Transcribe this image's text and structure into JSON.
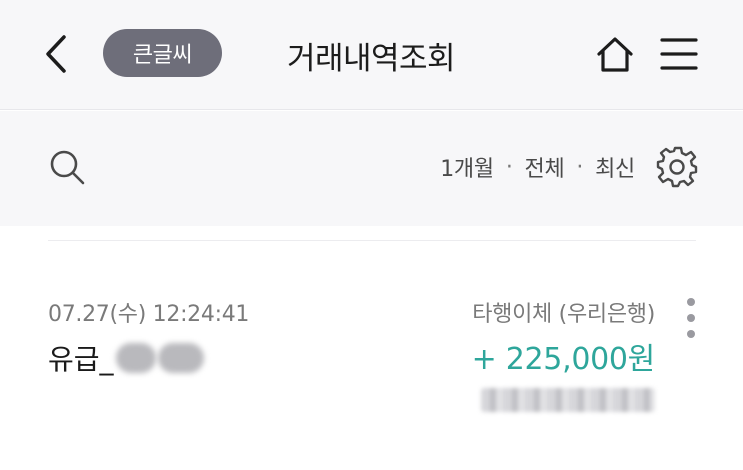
{
  "header": {
    "back_icon": "chevron-left-icon",
    "large_text_label": "큰글씨",
    "title": "거래내역조회",
    "home_icon": "home-icon",
    "menu_icon": "hamburger-menu-icon"
  },
  "filter": {
    "search_icon": "search-icon",
    "period": "1개월",
    "separator": "·",
    "type": "전체",
    "order": "최신",
    "settings_icon": "gear-icon"
  },
  "transactions": [
    {
      "datetime": "07.27(수) 12:24:41",
      "name_prefix": "유급_",
      "transfer_type": "타행이체 (우리은행)",
      "amount": "+ 225,000원",
      "more_icon": "more-vertical-icon"
    }
  ],
  "colors": {
    "header_bg": "#f7f7f9",
    "pill_bg": "#6e6e7a",
    "amount_positive": "#2ea69b"
  }
}
